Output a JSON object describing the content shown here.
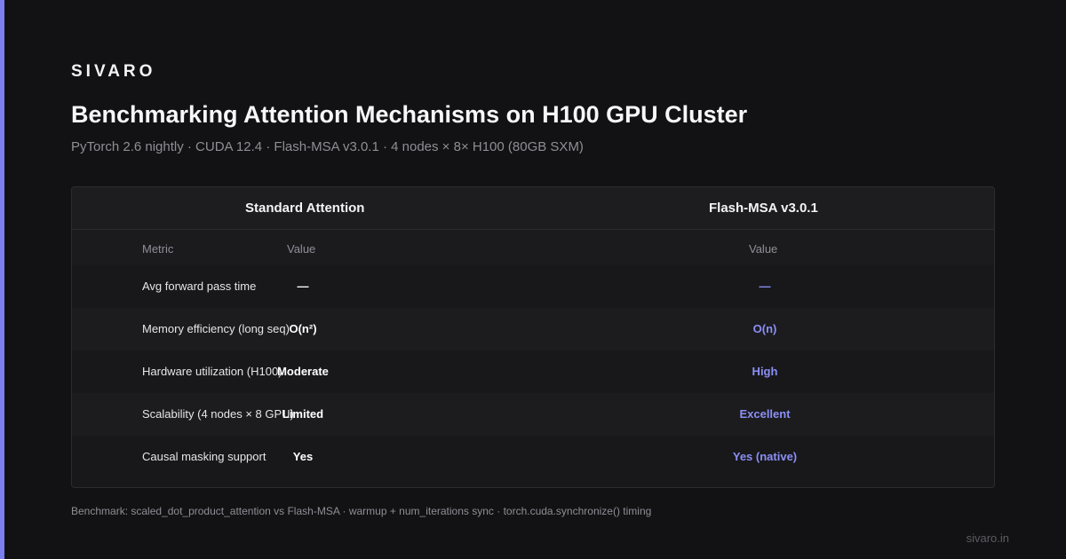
{
  "brand": "SIVARO",
  "title": "Benchmarking Attention Mechanisms on H100 GPU Cluster",
  "subtitle": "PyTorch 2.6 nightly · CUDA 12.4 · Flash-MSA v3.0.1 · 4 nodes × 8× H100 (80GB SXM)",
  "colors": {
    "accent": "#7b7ff0",
    "background": "#121214",
    "flash_value": "#8b8ff5"
  },
  "table": {
    "groups": [
      "Standard Attention",
      "Flash-MSA v3.0.1"
    ],
    "columns": {
      "metric": "Metric",
      "standard_value": "Value",
      "flash_value": "Value"
    },
    "rows": [
      {
        "metric": "Avg forward pass time",
        "standard": "—",
        "flash": "—"
      },
      {
        "metric": "Memory efficiency (long seq)",
        "standard": "O(n²)",
        "flash": "O(n)"
      },
      {
        "metric": "Hardware utilization (H100)",
        "standard": "Moderate",
        "flash": "High"
      },
      {
        "metric": "Scalability (4 nodes × 8 GPU)",
        "standard": "Limited",
        "flash": "Excellent"
      },
      {
        "metric": "Causal masking support",
        "standard": "Yes",
        "flash": "Yes (native)"
      }
    ]
  },
  "footnote": "Benchmark: scaled_dot_product_attention vs Flash-MSA · warmup + num_iterations sync · torch.cuda.synchronize() timing",
  "site": "sivaro.in"
}
